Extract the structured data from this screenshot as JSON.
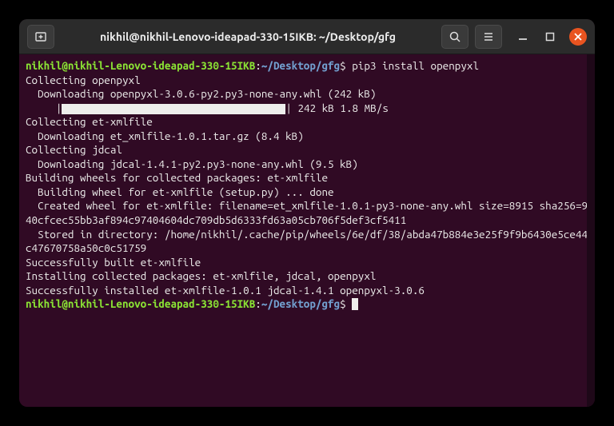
{
  "titlebar": {
    "title": "nikhil@nikhil-Lenovo-ideapad-330-15IKB: ~/Desktop/gfg"
  },
  "prompt": {
    "user_host": "nikhil@nikhil-Lenovo-ideapad-330-15IKB",
    "colon": ":",
    "path": "~/Desktop/gfg",
    "dollar": "$"
  },
  "command": "pip3 install openpyxl",
  "output": {
    "l1": "Collecting openpyxl",
    "l2": "  Downloading openpyxl-3.0.6-py2.py3-none-any.whl (242 kB)",
    "l3_prefix": "     |",
    "l3_suffix": "| 242 kB 1.8 MB/s",
    "l4": "Collecting et-xmlfile",
    "l5": "  Downloading et_xmlfile-1.0.1.tar.gz (8.4 kB)",
    "l6": "Collecting jdcal",
    "l7": "  Downloading jdcal-1.4.1-py2.py3-none-any.whl (9.5 kB)",
    "l8": "Building wheels for collected packages: et-xmlfile",
    "l9": "  Building wheel for et-xmlfile (setup.py) ... done",
    "l10": "  Created wheel for et-xmlfile: filename=et_xmlfile-1.0.1-py3-none-any.whl size=8915 sha256=940cfcec55bb3af894c97404604dc709db5d6333fd63a05cb706f5def3cf5411",
    "l11": "  Stored in directory: /home/nikhil/.cache/pip/wheels/6e/df/38/abda47b884e3e25f9f9b6430e5ce44c47670758a50c0c51759",
    "l12": "Successfully built et-xmlfile",
    "l13": "Installing collected packages: et-xmlfile, jdcal, openpyxl",
    "l14": "Successfully installed et-xmlfile-1.0.1 jdcal-1.4.1 openpyxl-3.0.6"
  }
}
